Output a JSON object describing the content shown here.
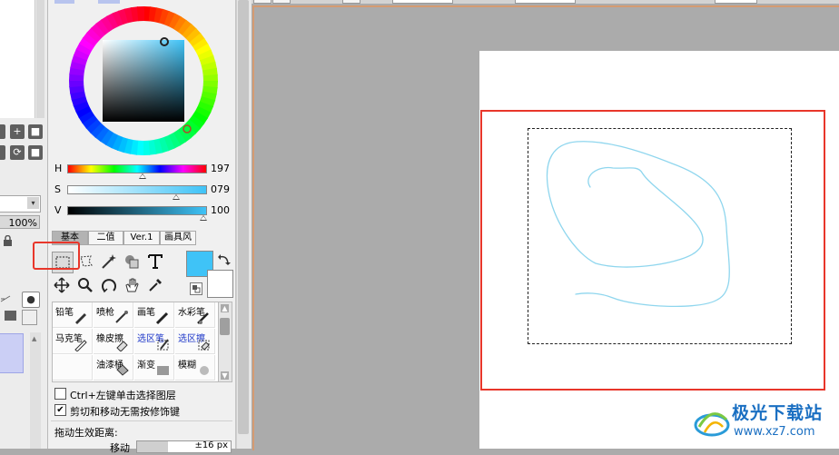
{
  "layers": {
    "opacity": "100%",
    "blend_arrow": "▾"
  },
  "color": {
    "h_label": "H",
    "h_value": "197",
    "s_label": "S",
    "s_value": "079",
    "v_label": "V",
    "v_value": "100",
    "foreground": "#3fc3f7",
    "background": "#ffffff"
  },
  "tool_tabs": [
    "基本",
    "二值",
    "Ver.1",
    "画具风"
  ],
  "tool_tab_active": 0,
  "brushes": [
    {
      "label": "铅笔",
      "icon": "pencil-icon",
      "blue": false
    },
    {
      "label": "喷枪",
      "icon": "airbrush-icon",
      "blue": false
    },
    {
      "label": "画笔",
      "icon": "brush-icon",
      "blue": false
    },
    {
      "label": "水彩笔",
      "icon": "watercolor-icon",
      "blue": false
    },
    {
      "label": "马克笔",
      "icon": "marker-icon",
      "blue": false
    },
    {
      "label": "橡皮擦",
      "icon": "eraser-icon",
      "blue": false
    },
    {
      "label": "选区笔",
      "icon": "selection-pen-icon",
      "blue": true
    },
    {
      "label": "选区擦",
      "icon": "selection-eraser-icon",
      "blue": true
    },
    {
      "label": "",
      "icon": "",
      "blue": false
    },
    {
      "label": "油漆桶",
      "icon": "bucket-icon",
      "blue": false
    },
    {
      "label": "渐变",
      "icon": "gradient-icon",
      "blue": false
    },
    {
      "label": "模糊",
      "icon": "blur-icon",
      "blue": false
    }
  ],
  "options": {
    "ctrl_click_label": "Ctrl+左键单击选择图层",
    "ctrl_click_checked": false,
    "cut_move_label": "剪切和移动无需按修饰键",
    "cut_move_checked": true,
    "drag_distance_label": "拖动生效距离:",
    "move_label": "移动",
    "move_value": "±16 px"
  },
  "watermark": {
    "title": "极光下载站",
    "url": "www.xz7.com"
  },
  "colors": {
    "accent_red": "#e8362a",
    "stroke_cyan": "#8fd6ee"
  }
}
